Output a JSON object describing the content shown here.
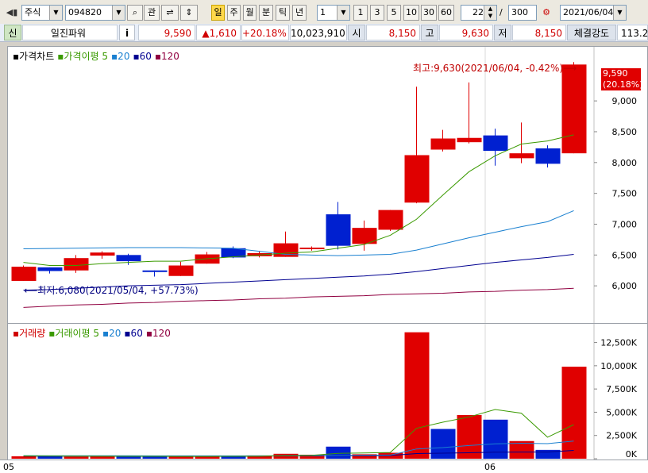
{
  "toolbar": {
    "market_select": "주식",
    "code_input": "094820",
    "search_icon": "magnifier-icon",
    "btn_gwan": "관",
    "period_buttons": [
      "일",
      "주",
      "월",
      "분",
      "틱",
      "년"
    ],
    "period_selected": "일",
    "interval_select": "1",
    "interval_buttons": [
      "1",
      "3",
      "5",
      "10",
      "30",
      "60"
    ],
    "count_input": "22",
    "total_count": "300",
    "slash": "/",
    "date_select": "2021/06/04"
  },
  "quote": {
    "credit_badge": "신",
    "name": "일진파워",
    "info_button": "i",
    "price": "9,590",
    "change": "▲1,610",
    "change_pct": "+20.18%",
    "volume": "10,023,910",
    "open_label": "시",
    "open": "8,150",
    "high_label": "고",
    "high": "9,630",
    "low_label": "저",
    "low": "8,150",
    "strength_label": "체결강도",
    "strength": "113.2"
  },
  "price_pane": {
    "legend": [
      {
        "text": "가격차트",
        "color": "#000000"
      },
      {
        "text": "가격이평 5",
        "color": "#3a9a00"
      },
      {
        "text": "20",
        "color": "#1a80d0"
      },
      {
        "text": "60",
        "color": "#000090"
      },
      {
        "text": "120",
        "color": "#900040"
      }
    ],
    "high_annotation": "최고:9,630(2021/06/04, -0.42%)⟶",
    "low_annotation": "⟵최저:6,080(2021/05/04, +57.73%)",
    "current_price_tag": "9,590",
    "current_pct_tag": "(20.18%)"
  },
  "volume_pane": {
    "legend": [
      {
        "text": "거래량",
        "color": "#d00000"
      },
      {
        "text": "거래이평 5",
        "color": "#3a9a00"
      },
      {
        "text": "20",
        "color": "#1a80d0"
      },
      {
        "text": "60",
        "color": "#000090"
      },
      {
        "text": "120",
        "color": "#900040"
      }
    ]
  },
  "x_axis": {
    "labels": [
      "05",
      "06"
    ]
  },
  "chart_data": [
    {
      "type": "candlestick",
      "ylim": [
        5500,
        9800
      ],
      "y_ticks": [
        6000,
        6500,
        7000,
        7500,
        8000,
        8500,
        9000
      ],
      "y_tick_labels": [
        "6,000",
        "6,500",
        "7,000",
        "7,500",
        "8,000",
        "8,500",
        "9,000"
      ],
      "candles": [
        {
          "o": 6080,
          "h": 6330,
          "l": 6080,
          "c": 6310,
          "up": true
        },
        {
          "o": 6300,
          "h": 6300,
          "l": 6200,
          "c": 6240,
          "up": false
        },
        {
          "o": 6250,
          "h": 6500,
          "l": 6210,
          "c": 6450,
          "up": true
        },
        {
          "o": 6490,
          "h": 6560,
          "l": 6440,
          "c": 6540,
          "up": true
        },
        {
          "o": 6500,
          "h": 6520,
          "l": 6340,
          "c": 6400,
          "up": false
        },
        {
          "o": 6250,
          "h": 6250,
          "l": 6150,
          "c": 6240,
          "up": false
        },
        {
          "o": 6160,
          "h": 6390,
          "l": 6160,
          "c": 6330,
          "up": true
        },
        {
          "o": 6360,
          "h": 6550,
          "l": 6360,
          "c": 6510,
          "up": true
        },
        {
          "o": 6610,
          "h": 6640,
          "l": 6450,
          "c": 6460,
          "up": false
        },
        {
          "o": 6480,
          "h": 6560,
          "l": 6460,
          "c": 6530,
          "up": true
        },
        {
          "o": 6470,
          "h": 6880,
          "l": 6470,
          "c": 6690,
          "up": true
        },
        {
          "o": 6620,
          "h": 6640,
          "l": 6570,
          "c": 6600,
          "up": true
        },
        {
          "o": 7160,
          "h": 7360,
          "l": 6590,
          "c": 6650,
          "up": false
        },
        {
          "o": 6680,
          "h": 7060,
          "l": 6570,
          "c": 6940,
          "up": true
        },
        {
          "o": 6910,
          "h": 7230,
          "l": 6890,
          "c": 7230,
          "up": true
        },
        {
          "o": 7350,
          "h": 9230,
          "l": 7340,
          "c": 8120,
          "up": true
        },
        {
          "o": 8210,
          "h": 8530,
          "l": 8180,
          "c": 8390,
          "up": true
        },
        {
          "o": 8400,
          "h": 9300,
          "l": 8310,
          "c": 8330,
          "up": true
        },
        {
          "o": 8440,
          "h": 8550,
          "l": 7950,
          "c": 8190,
          "up": false
        },
        {
          "o": 8150,
          "h": 8650,
          "l": 7990,
          "c": 8070,
          "up": true
        },
        {
          "o": 8230,
          "h": 8280,
          "l": 7920,
          "c": 7980,
          "up": false
        },
        {
          "o": 8150,
          "h": 9630,
          "l": 8150,
          "c": 9590,
          "up": true
        }
      ],
      "ma5": [
        6380,
        6330,
        6330,
        6360,
        6380,
        6400,
        6400,
        6440,
        6470,
        6500,
        6530,
        6550,
        6610,
        6670,
        6820,
        7080,
        7470,
        7850,
        8110,
        8300,
        8350,
        8450
      ],
      "ma20": [
        6600,
        6605,
        6610,
        6615,
        6620,
        6620,
        6620,
        6615,
        6610,
        6560,
        6510,
        6500,
        6490,
        6500,
        6510,
        6580,
        6680,
        6780,
        6870,
        6960,
        7040,
        7220
      ],
      "ma60": [
        5930,
        5940,
        5960,
        5980,
        6000,
        6010,
        6020,
        6040,
        6060,
        6080,
        6100,
        6120,
        6140,
        6160,
        6190,
        6230,
        6280,
        6330,
        6380,
        6420,
        6460,
        6510
      ],
      "ma120": [
        5650,
        5670,
        5690,
        5700,
        5720,
        5730,
        5750,
        5760,
        5770,
        5790,
        5800,
        5820,
        5830,
        5840,
        5860,
        5870,
        5880,
        5900,
        5910,
        5930,
        5940,
        5960
      ]
    },
    {
      "type": "bar",
      "ylim": [
        0,
        14000
      ],
      "y_ticks": [
        0,
        2500,
        5000,
        7500,
        10000,
        12500
      ],
      "y_tick_labels": [
        "0K",
        "2,500K",
        "5,000K",
        "7,500K",
        "10,000K",
        "12,500K"
      ],
      "values": [
        260,
        270,
        230,
        250,
        250,
        220,
        240,
        280,
        270,
        350,
        530,
        430,
        1300,
        480,
        640,
        13600,
        3200,
        4700,
        4200,
        1900,
        950,
        9900
      ],
      "up": [
        true,
        false,
        true,
        true,
        false,
        false,
        true,
        true,
        false,
        true,
        true,
        true,
        false,
        true,
        true,
        true,
        false,
        true,
        false,
        true,
        false,
        true
      ],
      "ma5": [
        300,
        290,
        280,
        270,
        260,
        252,
        244,
        244,
        252,
        266,
        338,
        366,
        576,
        618,
        668,
        3272,
        3930,
        4486,
        5288,
        4900,
        2312,
        3660
      ],
      "ma20": [
        330,
        325,
        320,
        318,
        316,
        313,
        310,
        308,
        306,
        305,
        310,
        315,
        350,
        370,
        390,
        1050,
        1200,
        1420,
        1600,
        1660,
        1620,
        1900
      ],
      "ma60": [
        280,
        280,
        282,
        284,
        284,
        284,
        285,
        286,
        287,
        290,
        300,
        305,
        320,
        330,
        340,
        560,
        600,
        640,
        700,
        720,
        720,
        900
      ]
    }
  ]
}
